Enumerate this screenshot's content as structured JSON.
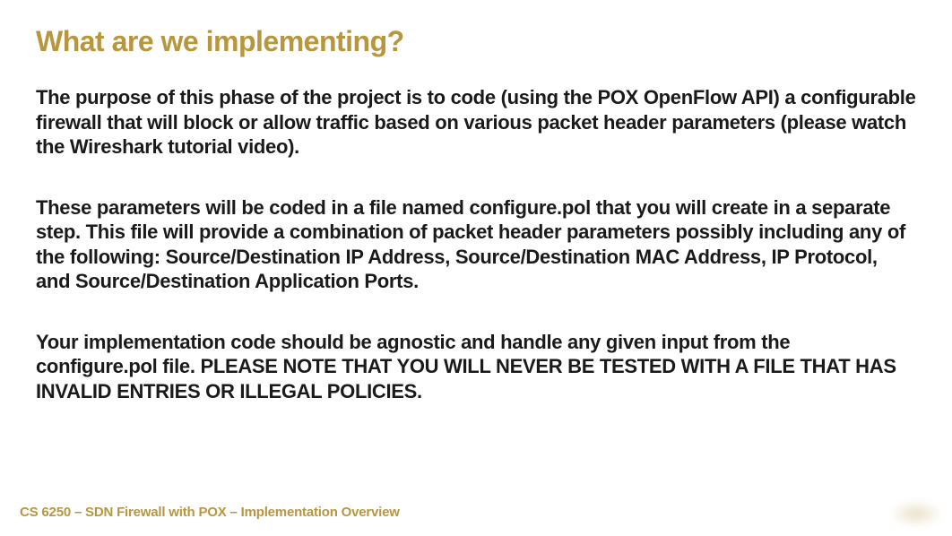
{
  "slide": {
    "title": "What are we implementing?",
    "paragraphs": {
      "p1": "The purpose of this phase of the project is to code (using the POX OpenFlow API) a configurable firewall that will block or allow traffic based on various packet header parameters (please watch the Wireshark tutorial video).",
      "p2": "These parameters will be coded in a file named configure.pol that you will create in a separate step.  This file will provide a combination of packet header parameters possibly including any of the following:  Source/Destination IP Address, Source/Destination MAC Address, IP Protocol, and Source/Destination Application Ports.",
      "p3": "Your implementation code should be agnostic and handle any given input from the configure.pol file.  PLEASE NOTE THAT YOU WILL NEVER BE TESTED WITH A FILE THAT HAS INVALID ENTRIES OR ILLEGAL POLICIES."
    },
    "footer": "CS 6250 – SDN Firewall with POX – Implementation Overview"
  },
  "colors": {
    "accent": "#b8963d",
    "text": "#1a1a1a",
    "background": "#ffffff"
  }
}
